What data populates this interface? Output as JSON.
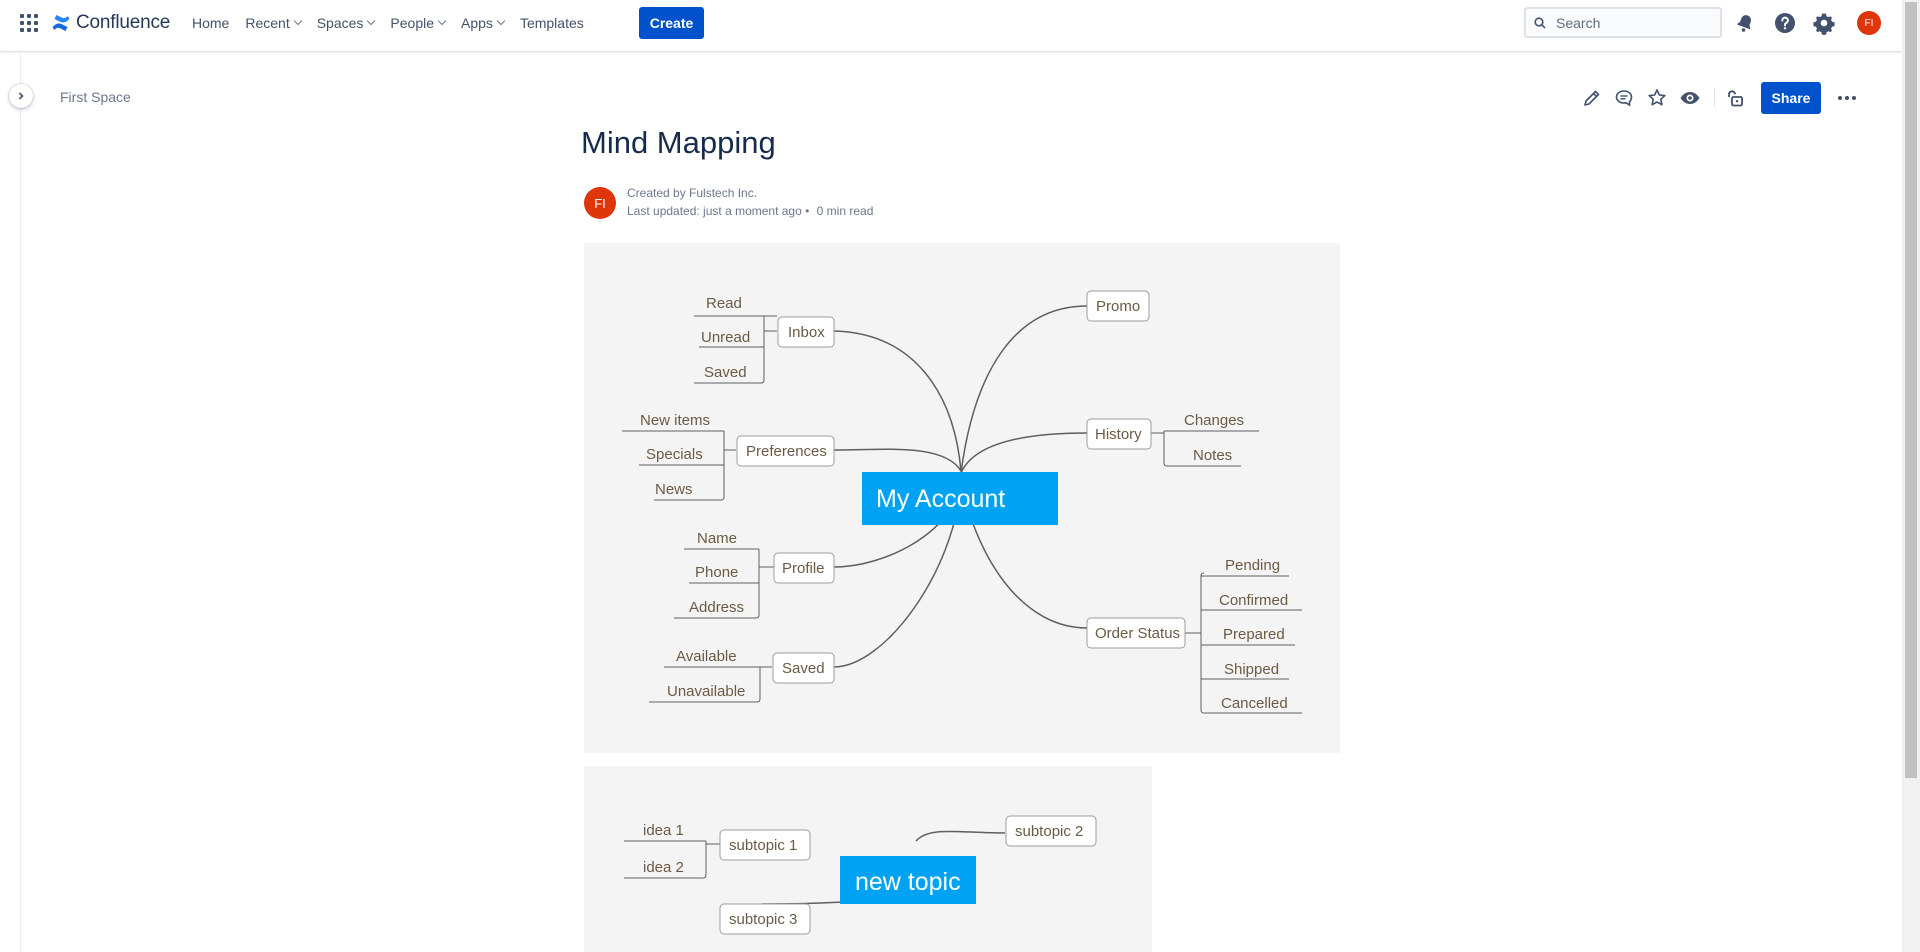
{
  "topnav": {
    "product_name": "Confluence",
    "items": [
      {
        "label": "Home",
        "dropdown": false
      },
      {
        "label": "Recent",
        "dropdown": true
      },
      {
        "label": "Spaces",
        "dropdown": true
      },
      {
        "label": "People",
        "dropdown": true
      },
      {
        "label": "Apps",
        "dropdown": true
      },
      {
        "label": "Templates",
        "dropdown": false
      }
    ],
    "create_label": "Create",
    "search_placeholder": "Search",
    "user_initials": "FI",
    "accent_color": "#0052cc",
    "avatar_color": "#de350b"
  },
  "breadcrumb": {
    "space": "First Space"
  },
  "page_actions": {
    "share_label": "Share"
  },
  "page": {
    "title": "Mind Mapping",
    "author_initials": "FI",
    "created_by": "Created by Fulstech Inc.",
    "last_updated": "Last updated: just a moment ago",
    "read_time": "0 min read"
  },
  "mindmap1": {
    "central": "My Account",
    "central_color": "#00a3f4",
    "topics": {
      "inbox": {
        "label": "Inbox",
        "items": [
          "Read",
          "Unread",
          "Saved"
        ]
      },
      "preferences": {
        "label": "Preferences",
        "items": [
          "New items",
          "Specials",
          "News"
        ]
      },
      "profile": {
        "label": "Profile",
        "items": [
          "Name",
          "Phone",
          "Address"
        ]
      },
      "saved": {
        "label": "Saved",
        "items": [
          "Available",
          "Unavailable"
        ]
      },
      "promo": {
        "label": "Promo",
        "items": []
      },
      "history": {
        "label": "History",
        "items": [
          "Changes",
          "Notes"
        ]
      },
      "order_status": {
        "label": "Order Status",
        "items": [
          "Pending",
          "Confirmed",
          "Prepared",
          "Shipped",
          "Cancelled"
        ]
      }
    }
  },
  "mindmap2": {
    "central": "new topic",
    "subtopic1": {
      "label": "subtopic 1",
      "items": [
        "idea 1",
        "idea 2"
      ]
    },
    "subtopic2": {
      "label": "subtopic 2"
    },
    "subtopic3": {
      "label": "subtopic 3"
    }
  }
}
